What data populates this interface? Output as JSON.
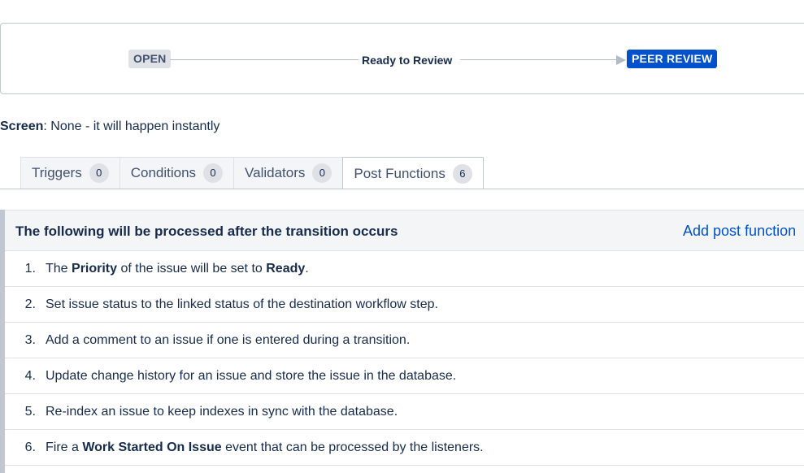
{
  "diagram": {
    "from_status": "OPEN",
    "transition": "Ready to Review",
    "to_status": "PEER REVIEW",
    "colors": {
      "from_bg": "#dfe1e6",
      "to_bg": "#0052cc"
    }
  },
  "screen": {
    "label": "Screen",
    "value": ": None - it will happen instantly"
  },
  "tabs": [
    {
      "label": "Triggers",
      "count": "0",
      "active": false
    },
    {
      "label": "Conditions",
      "count": "0",
      "active": false
    },
    {
      "label": "Validators",
      "count": "0",
      "active": false
    },
    {
      "label": "Post Functions",
      "count": "6",
      "active": true
    }
  ],
  "panel": {
    "title": "The following will be processed after the transition occurs",
    "add_link": "Add post function"
  },
  "post_functions": [
    {
      "num": "1.",
      "parts": [
        {
          "t": "The "
        },
        {
          "t": "Priority",
          "b": true
        },
        {
          "t": " of the issue will be set to "
        },
        {
          "t": "Ready",
          "b": true
        },
        {
          "t": "."
        }
      ]
    },
    {
      "num": "2.",
      "parts": [
        {
          "t": "Set issue status to the linked status of the destination workflow step."
        }
      ]
    },
    {
      "num": "3.",
      "parts": [
        {
          "t": "Add a comment to an issue if one is entered during a transition."
        }
      ]
    },
    {
      "num": "4.",
      "parts": [
        {
          "t": "Update change history for an issue and store the issue in the database."
        }
      ]
    },
    {
      "num": "5.",
      "parts": [
        {
          "t": "Re-index an issue to keep indexes in sync with the database."
        }
      ]
    },
    {
      "num": "6.",
      "parts": [
        {
          "t": "Fire a "
        },
        {
          "t": "Work Started On Issue",
          "b": true
        },
        {
          "t": " event that can be processed by the listeners."
        }
      ]
    }
  ]
}
